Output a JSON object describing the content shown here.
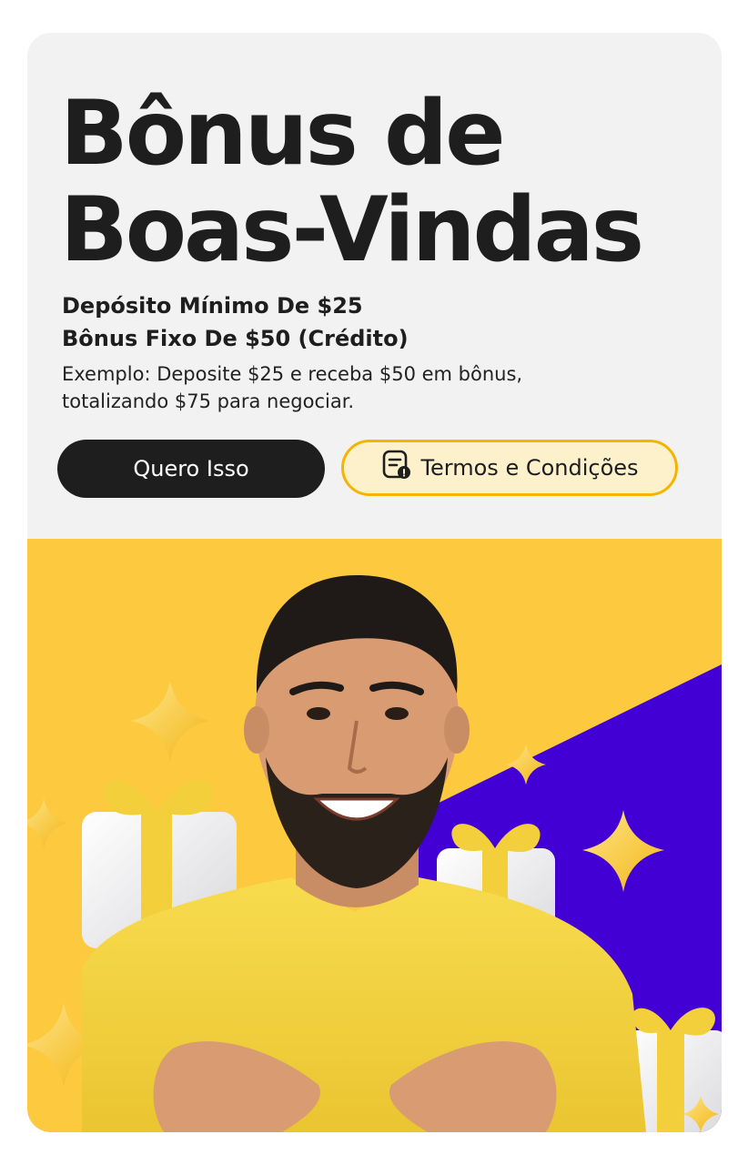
{
  "promo": {
    "title_line1": "Bônus de",
    "title_line2": "Boas-Vindas",
    "min_deposit": "Depósito Mínimo De $25",
    "fixed_bonus": "Bônus Fixo De $50 (Crédito)",
    "example": "Exemplo: Deposite $25 e receba $50 em bônus, totalizando $75 para negociar."
  },
  "actions": {
    "primary_label": "Quero Isso",
    "terms_label": "Termos e Condições",
    "terms_icon": "document-info-icon"
  },
  "colors": {
    "card_bg": "#f2f2f2",
    "banner_yellow": "#fcc93f",
    "banner_purple": "#4300d4",
    "primary_button": "#1e1e1e",
    "terms_border": "#f5b400",
    "terms_bg": "#fdf1cc"
  }
}
